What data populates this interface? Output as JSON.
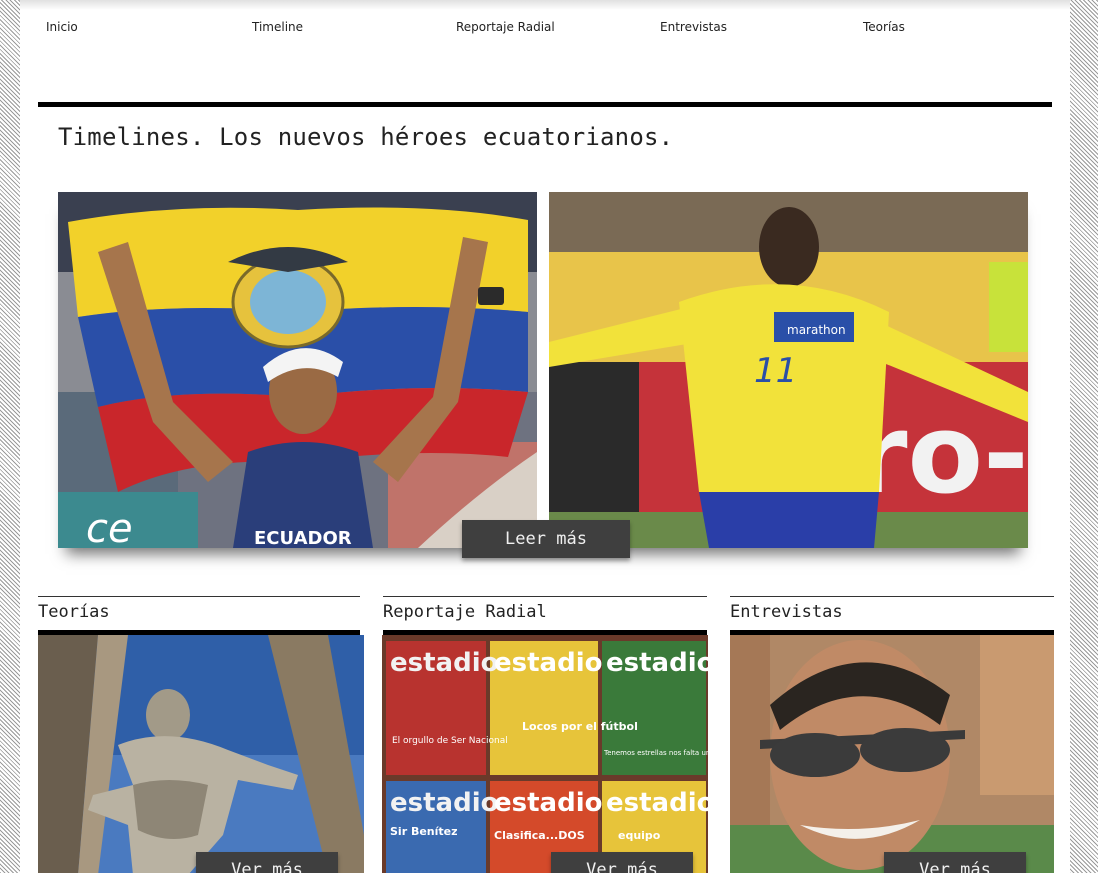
{
  "nav": {
    "items": [
      "Inicio",
      "Timeline",
      "Reportaje Radial",
      "Entrevistas",
      "Teorías"
    ]
  },
  "page_title": "Timelines. Los nuevos héroes ecuatorianos.",
  "hero": {
    "button_label": "Leer más",
    "left_image": {
      "shirt_text": "ECUADOR",
      "banner_text": "ce"
    },
    "right_image": {
      "jersey_number": "11",
      "sponsor_text": "marathon",
      "board_text": "aro-"
    }
  },
  "cards": [
    {
      "title": "Teorías",
      "button_label": "Ver más"
    },
    {
      "title": "Reportaje Radial",
      "button_label": "Ver más",
      "magazines": [
        "estadio",
        "estadio",
        "estadio",
        "estadio",
        "estadio",
        "estadio"
      ],
      "headlines": [
        "El orgullo de Ser Nacional",
        "Locos por el fútbol",
        "Tenemos estrellas nos falta un equipo",
        "Sir Benítez",
        "Clasifica...DOS",
        "equipo"
      ]
    },
    {
      "title": "Entrevistas",
      "button_label": "Ver más"
    }
  ],
  "colors": {
    "ecuador_yellow": "#f2d12a",
    "ecuador_blue": "#2a4fa8",
    "ecuador_red": "#c9262b",
    "button_bg": "#3f3f3f"
  }
}
